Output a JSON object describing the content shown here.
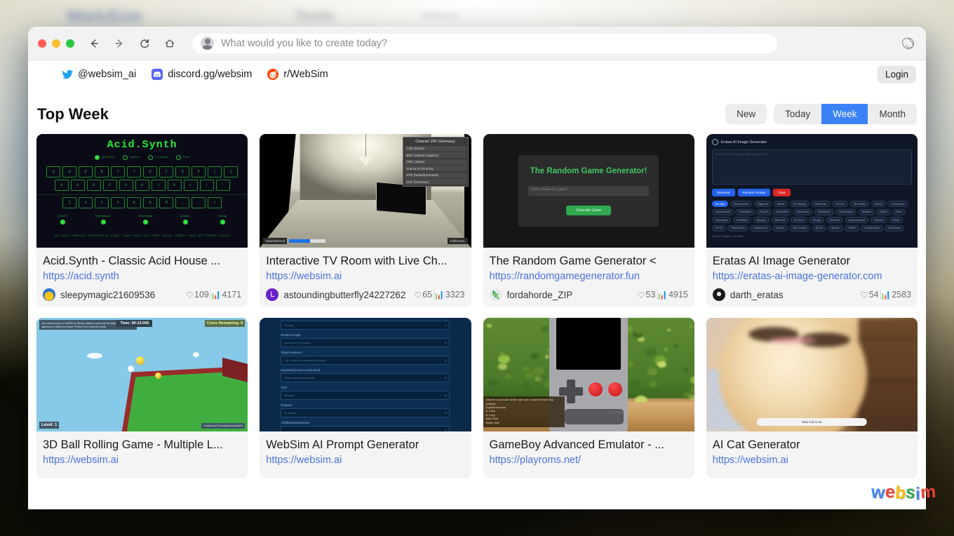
{
  "browser": {
    "omnibox_placeholder": "What would you like to create today?",
    "nav": {
      "back": "back-arrow",
      "forward": "forward-arrow",
      "reload": "reload",
      "home": "home"
    },
    "brand_icon": "spiral-icon"
  },
  "socialbar": {
    "links": [
      {
        "icon": "twitter-icon",
        "label": "@websim_ai"
      },
      {
        "icon": "discord-icon",
        "label": "discord.gg/websim"
      },
      {
        "icon": "reddit-icon",
        "label": "r/WebSim"
      }
    ],
    "login_label": "Login"
  },
  "page": {
    "title": "Top Week",
    "filters": {
      "new_label": "New",
      "segments": [
        {
          "label": "Today",
          "active": false
        },
        {
          "label": "Week",
          "active": true
        },
        {
          "label": "Month",
          "active": false
        }
      ]
    },
    "active_accent": "#3b82f6"
  },
  "cards": [
    {
      "title": "Acid.Synth - Classic Acid House ...",
      "url": "https://acid.synth",
      "author": "sleepymagic21609536",
      "likes": "109",
      "views": "4171",
      "thumb": "acid-synth-keyboard-ui",
      "thumb_text": {
        "title": "Acid.Synth",
        "waveforms": [
          "Sawtooth",
          "Square",
          "Triangle",
          "Sine"
        ],
        "row1": [
          "Q",
          "W",
          "E",
          "R",
          "T",
          "Y",
          "U",
          "I",
          "O",
          "P",
          "[",
          "]"
        ],
        "row2": [
          "A",
          "S",
          "D",
          "F",
          "G",
          "H",
          "J",
          "K",
          "L",
          ";",
          "'"
        ],
        "row3": [
          "Z",
          "X",
          "C",
          "V",
          "B",
          "N",
          "M",
          ",",
          ".",
          "/"
        ],
        "knobs": [
          "Cutoff",
          "Resonance",
          "Envelope",
          "Accent",
          "Decay"
        ],
        "footer": "Use your computer keyboard to play. Lower keys are lower notes, higher keys are higher notes!"
      }
    },
    {
      "title": "Interactive TV Room with Live Ch...",
      "url": "https://websim.ai",
      "author": "astoundingbutterfly24227262",
      "likes": "65",
      "views": "3323",
      "thumb": "3d-tv-room",
      "thumb_text": {
        "panel_title": "Channel: ZDF (Germany)",
        "channels": [
          "CNN (News)",
          "BBC (United Kingdom)",
          "NHK (Japan)",
          "France 24 (France)",
          "RTE (News/Euronews)",
          "ZDF (Germany)"
        ],
        "volume_label": "Volume/Scroll",
        "fullscreen_label": "Fullscreen"
      }
    },
    {
      "title": "The Random Game Generator <",
      "url": "https://randomgamegenerator.fun",
      "author": "fordahorde_ZIP",
      "likes": "53",
      "views": "4915",
      "thumb": "random-game-generator",
      "thumb_text": {
        "heading": "The Random Game Generator!",
        "input_placeholder": "Enter a theme for a game",
        "button": "Generate Game"
      }
    },
    {
      "title": "Eratas AI Image Generator",
      "url": "https://eratas-ai-image-generator.com",
      "author": "darth_eratas",
      "likes": "54",
      "views": "2583",
      "thumb": "eratas-ai-image-generator",
      "thumb_text": {
        "header": "Eratas AI Image Generator",
        "textarea_placeholder": "Describe the image you want to generate...",
        "buttons": [
          "Generate",
          "Random Prompt",
          "Clear"
        ],
        "tags": [
          "No Style",
          "Photorealistic",
          "Digital Art",
          "Anime",
          "Oil Painting",
          "Watercolor",
          "Pixel Art",
          "3D Render",
          "Sketch",
          "Comic Book",
          "Impressionist",
          "Surrealism",
          "Pop art",
          "Minimalist",
          "Cyberpunk",
          "Steampunk",
          "Art Nouveau",
          "Abstract",
          "Gothic",
          "Retro",
          "Vaporwave",
          "Pointillism",
          "Baroque",
          "Glitch Art",
          "Art Deco",
          "Grunge",
          "Medieval",
          "Expressionism",
          "Futurism",
          "Rustic",
          "B & W",
          "Psychedelic",
          "Lowbrow Art",
          "Sumi-e",
          "Neo Cubism",
          "Op Art",
          "Mosaic",
          "Graffiti",
          "Constructivist",
          "Synthwave"
        ],
        "footer": "Selected Engine: Era Style"
      }
    },
    {
      "title": "3D Ball Rolling Game - Multiple L...",
      "url": "https://websim.ai",
      "author": "",
      "likes": "",
      "views": "",
      "thumb": "3d-ball-rolling-game",
      "thumb_text": {
        "time": "Time: 00:15.005",
        "coins": "Coins Remaining: 5",
        "level": "Level: 1",
        "credit": "Created by Groovepatt and abc024",
        "help": "Use arrow keys or WASD to tilt the platform and roll the ball. Collect all spheres to finish the level. Press R to reset the level."
      }
    },
    {
      "title": "WebSim AI Prompt Generator",
      "url": "https://websim.ai",
      "author": "",
      "likes": "",
      "views": "",
      "thumb": "websim-prompt-generator-form",
      "thumb_text": {
        "fields": [
          {
            "label": "",
            "value": "Prompt"
          },
          {
            "label": "Desired Length",
            "value": "Short (50-100 words)"
          },
          {
            "label": "Target Audience",
            "value": "e.g. children, software developers"
          },
          {
            "label": "Keywords (comma separated)",
            "value": "Enter relevant keywords"
          },
          {
            "label": "Tone",
            "value": "Neutral"
          },
          {
            "label": "Purpose",
            "value": "To inform"
          },
          {
            "label": "Additional Instructions",
            "value": ""
          }
        ]
      }
    },
    {
      "title": "GameBoy Advanced Emulator - ...",
      "url": "https://playroms.net/",
      "author": "",
      "likes": "",
      "views": "",
      "thumb": "gameboy-emulator",
      "thumb_text": {
        "overlay": "Click the Load button on the right side to load the Game Boy.",
        "controls": [
          "Controls:",
          "D-pad/Arrow keys",
          "A: Z key",
          "B: X key",
          "Start: Enter",
          "Select: Shift"
        ]
      }
    },
    {
      "title": "AI Cat Generator",
      "url": "https://websim.ai",
      "author": "",
      "likes": "",
      "views": "",
      "thumb": "ai-cat-photo",
      "thumb_text": {
        "button": "New Cat in 5s"
      }
    }
  ],
  "watermark": {
    "letters": [
      {
        "char": "w",
        "color": "#4285f4"
      },
      {
        "char": "e",
        "color": "#ea4335"
      },
      {
        "char": "b",
        "color": "#fbbc05"
      },
      {
        "char": "s",
        "color": "#34a853"
      },
      {
        "char": "i",
        "color": "#4285f4"
      },
      {
        "char": "m",
        "color": "#ea4335"
      }
    ]
  }
}
